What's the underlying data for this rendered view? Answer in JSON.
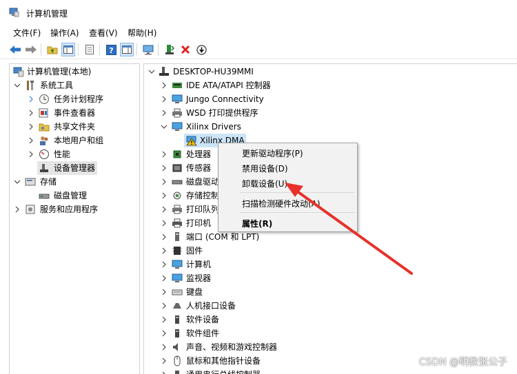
{
  "window": {
    "title": "计算机管理"
  },
  "menubar": {
    "items": [
      "文件(F)",
      "操作(A)",
      "查看(V)",
      "帮助(H)"
    ]
  },
  "toolbar": {
    "icons": [
      "back-arrow-icon",
      "forward-arrow-icon",
      "up-folder-icon",
      "console-tree-icon",
      "properties-icon",
      "help-icon",
      "show-hide-action-pane-icon",
      "monitor-icon",
      "update-driver-icon",
      "uninstall-x-icon",
      "disable-device-icon"
    ]
  },
  "left_tree": {
    "root": "计算机管理(本地)",
    "system_tools": "系统工具",
    "task_scheduler": "任务计划程序",
    "event_viewer": "事件查看器",
    "shared_folders": "共享文件夹",
    "local_users": "本地用户和组",
    "performance": "性能",
    "device_manager": "设备管理器",
    "storage": "存储",
    "disk_management": "磁盘管理",
    "services_apps": "服务和应用程序"
  },
  "device_tree": {
    "computer": "DESKTOP-HU39MMI",
    "items": [
      "IDE ATA/ATAPI 控制器",
      "Jungo Connectivity",
      "WSD 打印提供程序",
      "Xilinx Drivers",
      "Xilinx DMA",
      "处理器",
      "传感器",
      "磁盘驱动",
      "存储控制",
      "打印队列",
      "打印机",
      "端口 (COM 和 LPT)",
      "固件",
      "计算机",
      "监视器",
      "键盘",
      "人机接口设备",
      "软件设备",
      "软件组件",
      "声音、视频和游戏控制器",
      "鼠标和其他指针设备",
      "通用串行总线控制器"
    ]
  },
  "context_menu": {
    "update_driver": "更新驱动程序(P)",
    "disable_device": "禁用设备(D)",
    "uninstall_device": "卸载设备(U)",
    "scan_hardware": "扫描检测硬件改动(A)",
    "properties": "属性(R)"
  },
  "annotation": {
    "arrow_color": "#e8312a"
  },
  "watermark": "CSDN @明教张公子",
  "colors": {
    "warning": "#f5c400",
    "selection": "#e5e5e5",
    "accent": "#1f6fd1"
  }
}
